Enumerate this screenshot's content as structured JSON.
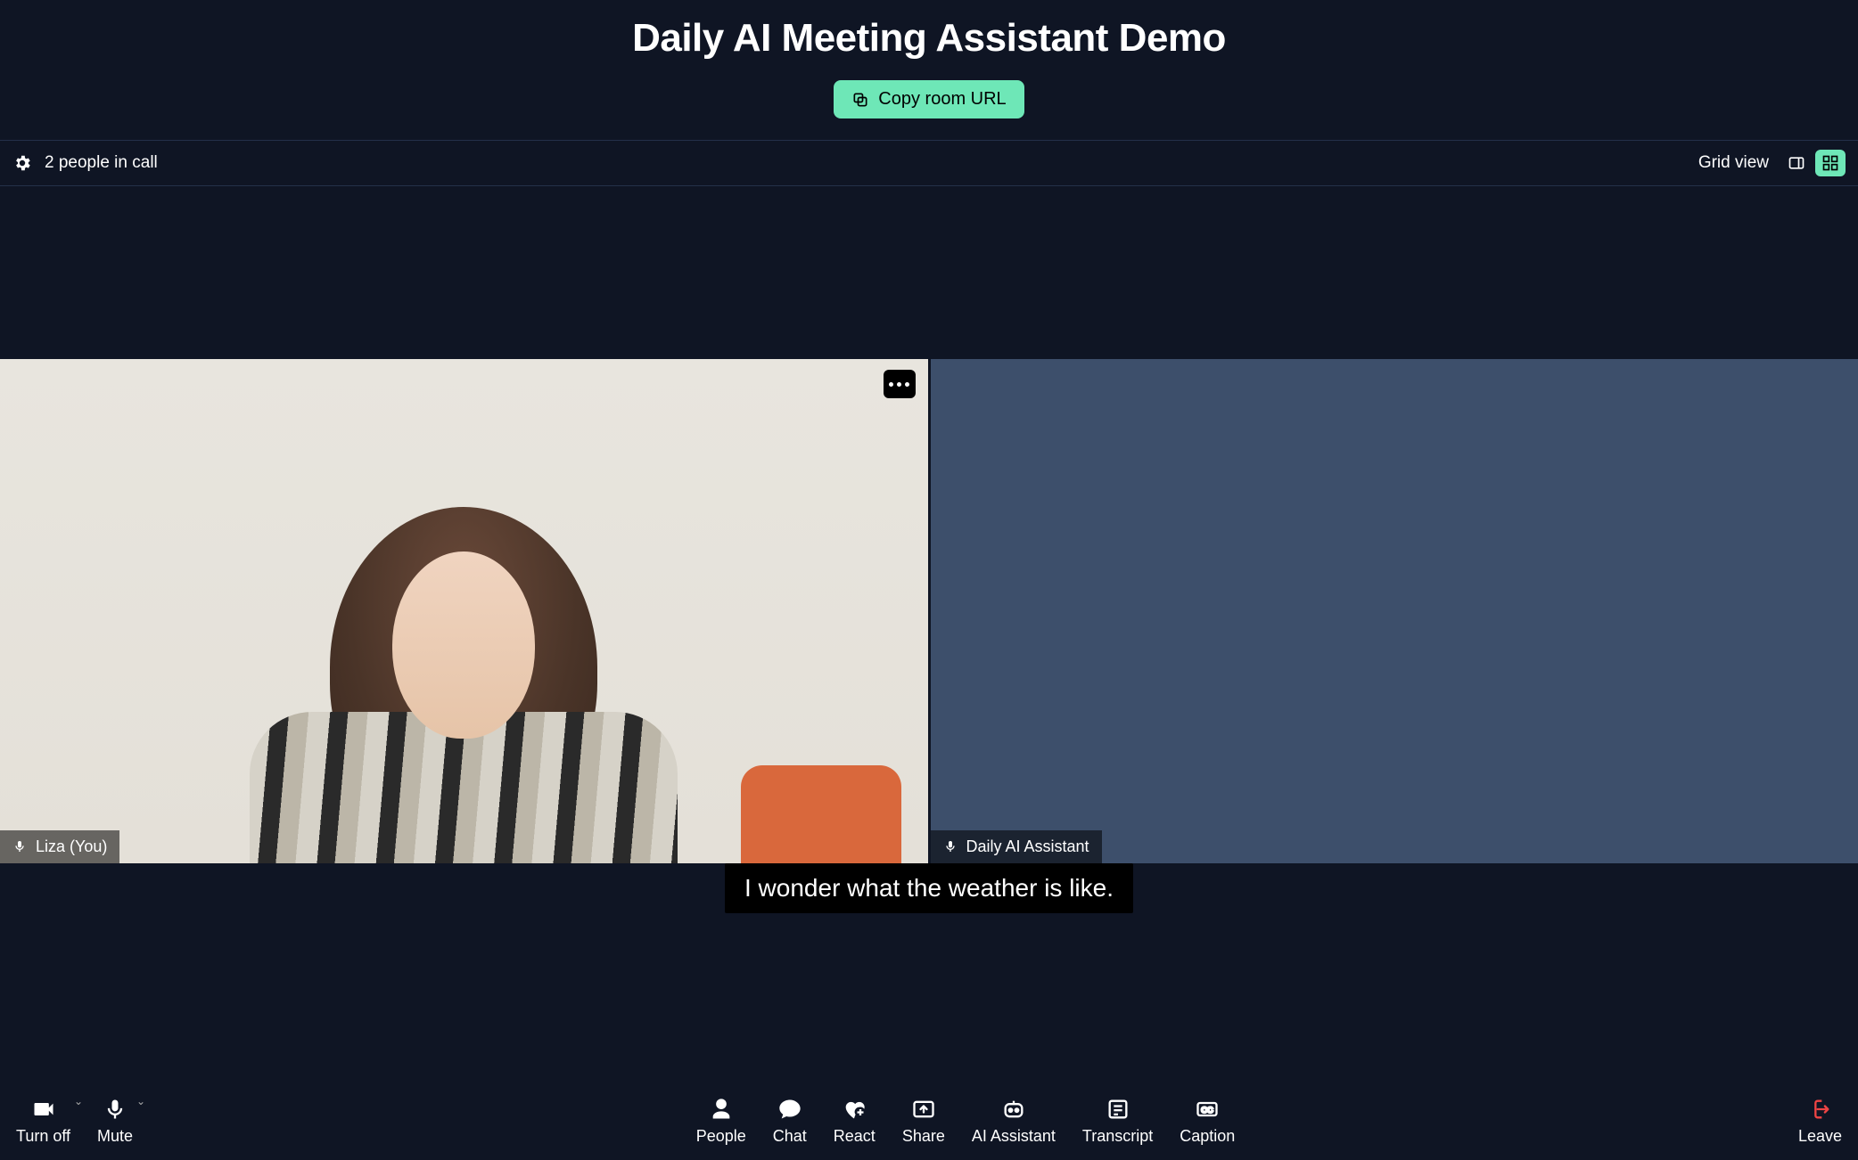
{
  "header": {
    "title": "Daily AI Meeting Assistant Demo",
    "copy_label": "Copy room URL"
  },
  "statusbar": {
    "people_text": "2 people in call",
    "view_label": "Grid view"
  },
  "tiles": [
    {
      "name": "Liza (You)",
      "is_self": true
    },
    {
      "name": "Daily AI Assistant",
      "is_self": false
    }
  ],
  "caption": "I wonder what the weather is like.",
  "controls": {
    "camera": "Turn off",
    "mic": "Mute",
    "people": "People",
    "chat": "Chat",
    "react": "React",
    "share": "Share",
    "ai": "AI Assistant",
    "transcript": "Transcript",
    "caption": "Caption",
    "leave": "Leave"
  }
}
